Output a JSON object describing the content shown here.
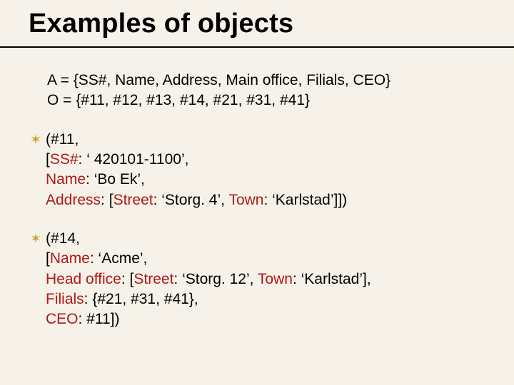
{
  "title": "Examples of objects",
  "defs": {
    "line1": "A = {SS#, Name, Address, Main office, Filials, CEO}",
    "line2": "O = {#11, #12, #13, #14, #21, #31, #41}"
  },
  "item1": {
    "l1a": "(#11,",
    "l2a": "[",
    "l2attr": "SS#",
    "l2b": ": ‘ 420101-1100’,",
    "l3attr": "Name",
    "l3b": ": ‘Bo Ek’,",
    "l4attr": "Address",
    "l4b": ": [",
    "l4attr2": "Street",
    "l4c": ": ‘Storg. 4’, ",
    "l4attr3": "Town",
    "l4d": ": ‘Karlstad’]])"
  },
  "item2": {
    "l1a": "(#14,",
    "l2a": "[",
    "l2attr": "Name",
    "l2b": ": ‘Acme’,",
    "l3attr": "Head office",
    "l3b": ": [",
    "l3attr2": "Street",
    "l3c": ": ‘Storg. 12’, ",
    "l3attr3": "Town",
    "l3d": ": ‘Karlstad’],",
    "l4attr": "Filials",
    "l4b": ": {#21, #31, #41},",
    "l5attr": "CEO",
    "l5b": ": #11])"
  },
  "bullet_glyph": "✶"
}
